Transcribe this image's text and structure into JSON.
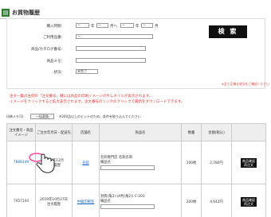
{
  "header": {
    "icon": "document-icon",
    "title": "お買物履歴"
  },
  "search": {
    "labels": {
      "date": "購入時期：",
      "category": "ご利用品番：",
      "product_code": "商品/カタログ番号：",
      "product_name": "商品メモ：",
      "status": "状況："
    },
    "date_units": {
      "y1": "年",
      "m1": "月へ",
      "y2": "年",
      "m2": "月"
    },
    "dropdown_placeholder": "—",
    "status_value": "未完了",
    "button_label": "検 索",
    "right_note": "※全て正確な状況をご確認ください"
  },
  "notice": {
    "line1": "注文一覧の左側の「注文番号」欄には商品の印刷イメージのサムネイルが表示されます。",
    "line2": "イメージをクリックすると拡大表示されます。注文番号のリンクのクリックで最新をダウンロードできます。"
  },
  "meta": {
    "prefix": "印刷メモ可(",
    "clear_button": "一括変換",
    "info": "※200品以上のヒットのため、条件を絞り込んでください"
  },
  "table": {
    "headers": [
      "注文番号・商品イメージ",
      "ご注文年月日・配送先",
      "店舗名",
      "商品名",
      "数量",
      "金額(税込)",
      ""
    ],
    "rows": [
      {
        "order_no": "7886249",
        "date": "2019年12月",
        "date2": "注文履歴",
        "store": "名前",
        "product": "名刺専門店 名刺名刺",
        "product2": "備品名",
        "qty": "100枚",
        "price": "2,780円",
        "action1": "商品確認",
        "action2": "再注文"
      },
      {
        "order_no": "7457144",
        "date": "2019年10月27日",
        "date2": "注文履歴",
        "store": "中級印刷室",
        "product": "封筒(角2)-(A判(角2)) C-203",
        "product2": "備品名",
        "qty": "200枚",
        "price": "4,642円",
        "action1": "商品確認",
        "action2": "再注文"
      }
    ]
  }
}
